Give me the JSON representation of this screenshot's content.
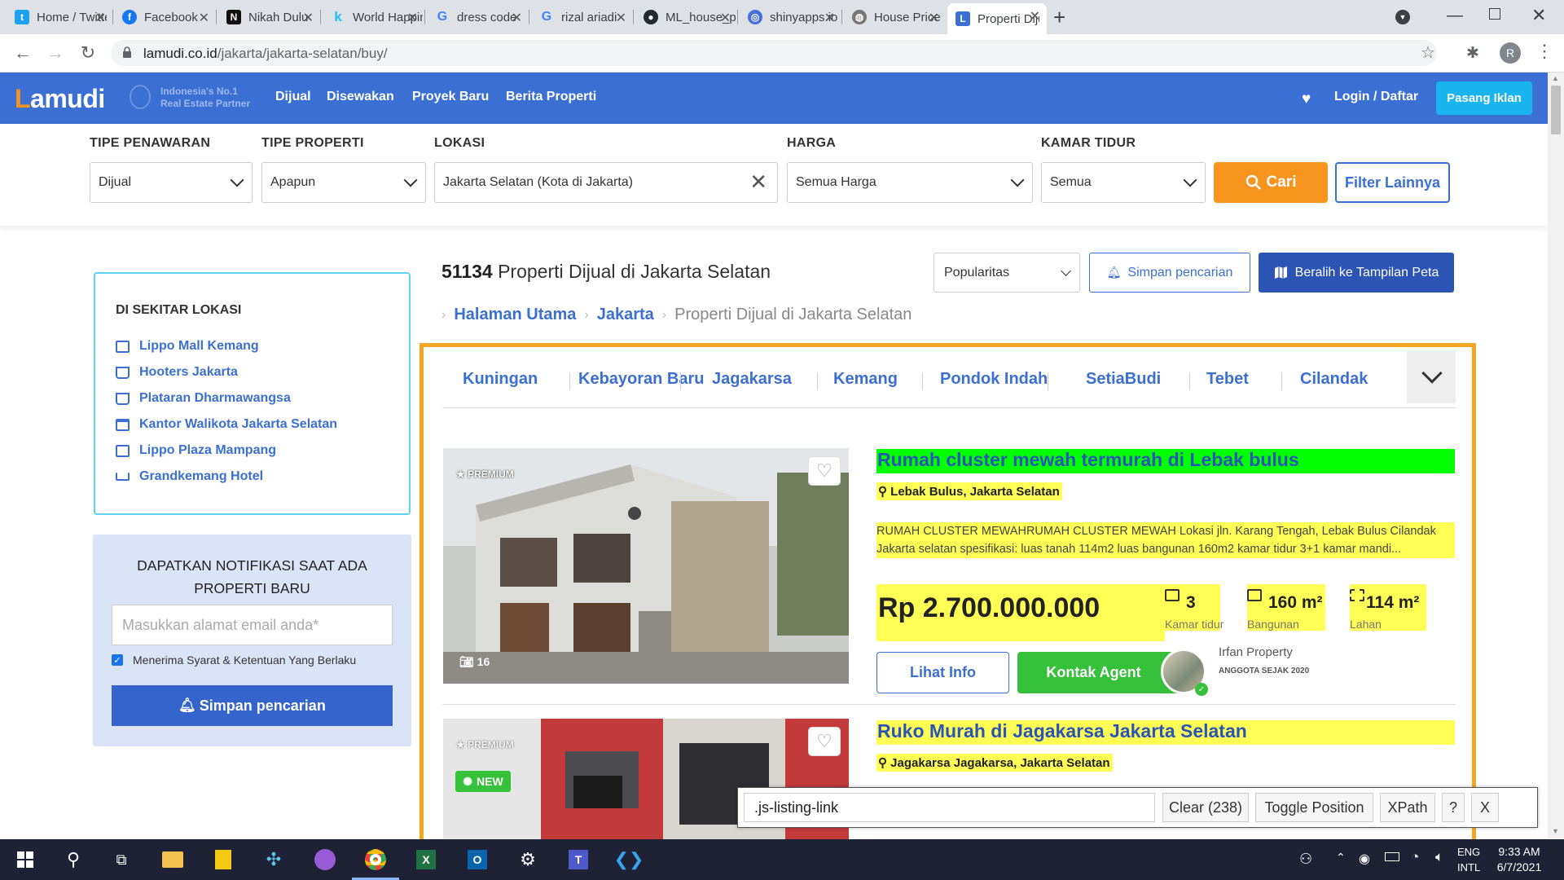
{
  "browser": {
    "tabs": [
      {
        "label": "Home / Twitter",
        "icon": "twitter-icon",
        "color": "#1da1f2",
        "glyph": "t"
      },
      {
        "label": "Facebook",
        "icon": "facebook-icon",
        "color": "#1877f2",
        "glyph": "f"
      },
      {
        "label": "Nikah Dulu",
        "icon": "webtoon-icon",
        "color": "#111111",
        "glyph": "N"
      },
      {
        "label": "World Happiness",
        "icon": "kaggle-icon",
        "color": "#20beff",
        "glyph": "k"
      },
      {
        "label": "dress code",
        "icon": "google-icon",
        "color": "#4285f4",
        "glyph": "G"
      },
      {
        "label": "rizal ariadi",
        "icon": "google-icon",
        "color": "#4285f4",
        "glyph": "G"
      },
      {
        "label": "ML_house_price",
        "icon": "github-icon",
        "color": "#24292e",
        "glyph": "●"
      },
      {
        "label": "shinyapps.io",
        "icon": "shinyapps-icon",
        "color": "#4a6fd8",
        "glyph": "◎"
      },
      {
        "label": "House Price",
        "icon": "globe-icon",
        "color": "#777777",
        "glyph": "◍"
      },
      {
        "label": "Properti Dijual",
        "icon": "lamudi-tab-icon",
        "color": "#3b6fd4",
        "glyph": "L"
      }
    ],
    "url_host": "lamudi.co.id",
    "url_path": "/jakarta/jakarta-selatan/buy/",
    "profile_initial": "R"
  },
  "header": {
    "logo_text": "Lamudi",
    "tagline_1": "Indonesia's No.1",
    "tagline_2": "Real Estate Partner",
    "nav": [
      "Dijual",
      "Disewakan",
      "Proyek Baru",
      "Berita Properti"
    ],
    "login": "Login / Daftar",
    "post_ad": "Pasang Iklan"
  },
  "filters": {
    "offer_label": "TIPE PENAWARAN",
    "offer_value": "Dijual",
    "type_label": "TIPE PROPERTI",
    "type_value": "Apapun",
    "location_label": "LOKASI",
    "location_value": "Jakarta Selatan (Kota di Jakarta)",
    "price_label": "HARGA",
    "price_value": "Semua Harga",
    "bedroom_label": "KAMAR TIDUR",
    "bedroom_value": "Semua",
    "search_button": "Cari",
    "more_filters": "Filter Lainnya"
  },
  "sidebar": {
    "nearby_title": "DI SEKITAR LOKASI",
    "nearby": [
      {
        "label": "Lippo Mall Kemang",
        "icon": "shopping-bag-icon"
      },
      {
        "label": "Hooters Jakarta",
        "icon": "cart-icon"
      },
      {
        "label": "Plataran Dharmawangsa",
        "icon": "cart-icon"
      },
      {
        "label": "Kantor Walikota Jakarta Selatan",
        "icon": "government-building-icon"
      },
      {
        "label": "Lippo Plaza Mampang",
        "icon": "shopping-bag-icon"
      },
      {
        "label": "Grandkemang Hotel",
        "icon": "bed-icon"
      }
    ],
    "notif_title": "DAPATKAN NOTIFIKASI SAAT ADA PROPERTI BARU",
    "email_placeholder": "Masukkan alamat email anda*",
    "terms": "Menerima Syarat & Ketentuan Yang Berlaku",
    "save_button": "Simpan pencarian"
  },
  "results": {
    "count": "51134",
    "count_text": "Properti Dijual di Jakarta Selatan",
    "sort_value": "Popularitas",
    "save_search": "Simpan pencarian",
    "map_view": "Beralih ke Tampilan Peta",
    "breadcrumb": [
      "Halaman Utama",
      "Jakarta",
      "Properti Dijual di Jakarta Selatan"
    ],
    "areas": [
      "Kuningan",
      "Kebayoran Baru",
      "Jagakarsa",
      "Kemang",
      "Pondok Indah",
      "SetiaBudi",
      "Tebet",
      "Cilandak"
    ]
  },
  "listings": [
    {
      "badge": "PREMIUM",
      "photos": "16",
      "title": "Rumah cluster mewah termurah di Lebak bulus",
      "location": "Lebak Bulus, Jakarta Selatan",
      "description": "RUMAH CLUSTER MEWAHRUMAH CLUSTER MEWAH Lokasi jln. Karang Tengah, Lebak Bulus Cilandak Jakarta selatan spesifikasi: luas tanah 114m2 luas bangunan 160m2 kamar tidur 3+1 kamar mandi...",
      "price": "Rp 2.700.000.000",
      "bedrooms": "3",
      "bedrooms_label": "Kamar tidur",
      "building": "160 m²",
      "building_label": "Bangunan",
      "land": "114 m²",
      "land_label": "Lahan",
      "view_button": "Lihat Info",
      "contact_button": "Kontak Agent",
      "agent_name": "Irfan Property",
      "agent_since": "ANGGOTA SEJAK 2020",
      "title_highlight": "#00ff00"
    },
    {
      "badge": "PREMIUM",
      "new_badge": "NEW",
      "title": "Ruko Murah di Jagakarsa Jakarta Selatan",
      "location": "Jagakarsa Jagakarsa, Jakarta Selatan",
      "title_highlight": "#ffff55"
    }
  ],
  "selector_tool": {
    "query": ".js-listing-link",
    "clear": "Clear (238)",
    "toggle": "Toggle Position",
    "xpath": "XPath",
    "help": "?",
    "close": "X"
  },
  "taskbar": {
    "lang_1": "ENG",
    "lang_2": "INTL",
    "time": "9:33 AM",
    "date": "6/7/2021"
  },
  "colors": {
    "brand_blue": "#3b6fd4",
    "brand_orange": "#f7941e",
    "highlight_yellow": "#ffff55",
    "highlight_green": "#00ff00",
    "outline_orange": "#f5a623"
  }
}
